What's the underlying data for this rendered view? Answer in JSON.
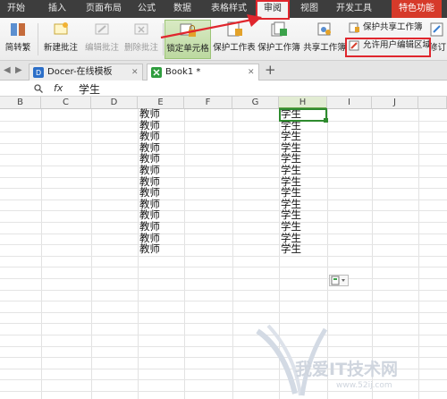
{
  "menu": {
    "items": [
      {
        "label": "开始"
      },
      {
        "label": "插入"
      },
      {
        "label": "页面布局"
      },
      {
        "label": "公式"
      },
      {
        "label": "数据"
      },
      {
        "label": "表格样式"
      },
      {
        "label": "审阅"
      },
      {
        "label": "视图"
      },
      {
        "label": "开发工具"
      },
      {
        "label": "特色功能"
      }
    ]
  },
  "ribbon": {
    "jianzhuanfan": "简转繁",
    "new_comment": "新建批注",
    "edit_comment": "编辑批注",
    "delete_comment": "删除批注",
    "lock_cell": "锁定单元格",
    "protect_sheet": "保护工作表",
    "protect_workbook": "保护工作簿",
    "share_workbook": "共享工作簿",
    "protect_share_workbook": "保护共享工作簿",
    "allow_edit_ranges": "允许用户编辑区域",
    "track_changes": "修订"
  },
  "tabs": {
    "docer": "Docer-在线模板",
    "book1": "Book1 *"
  },
  "formula_bar": {
    "fx": "fx",
    "value": "学生"
  },
  "grid": {
    "columns": [
      "B",
      "C",
      "D",
      "E",
      "F",
      "G",
      "H",
      "I",
      "J"
    ],
    "column_e": [
      "教师",
      "教师",
      "教师",
      "教师",
      "教师",
      "教师",
      "教师",
      "教师",
      "教师",
      "教师",
      "教师",
      "教师",
      "教师"
    ],
    "column_h": [
      "学生",
      "学生",
      "学生",
      "学生",
      "学生",
      "学生",
      "学生",
      "学生",
      "学生",
      "学生",
      "学生",
      "学生",
      "学生"
    ]
  },
  "watermark": {
    "text": "我爱IT技术网",
    "url": "www.52ij.com"
  },
  "colors": {
    "menubar": "#3d3d3d",
    "annotation_red": "#e0262d",
    "selection_green": "#2e8b2e"
  }
}
